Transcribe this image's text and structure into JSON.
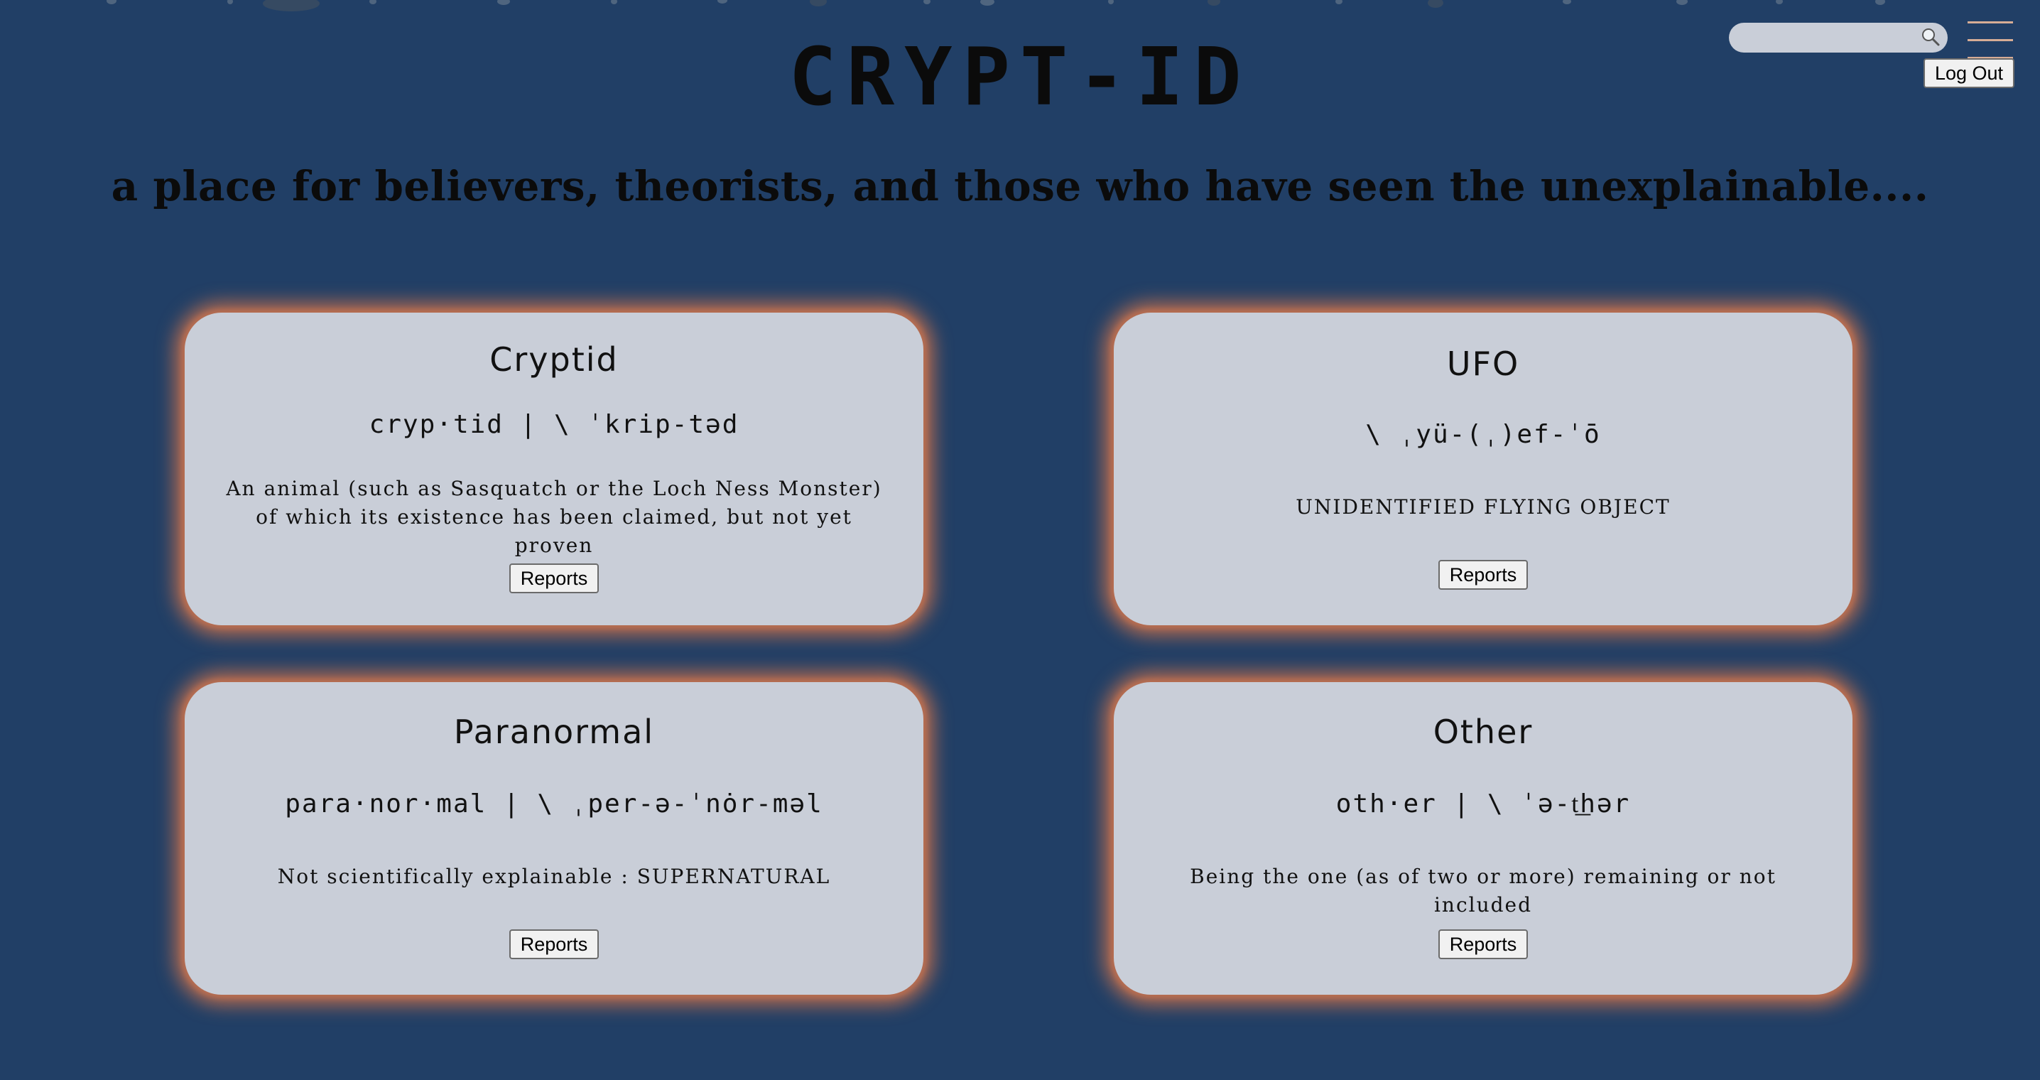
{
  "header": {
    "search_value": "",
    "search_icon": "magnifier-icon",
    "menu_icon": "hamburger-icon",
    "logout_label": "Log Out",
    "title": "CRYPT-ID",
    "tagline": "a place for believers, theorists, and those who have seen the unexplainable...."
  },
  "categories": [
    {
      "title": "Cryptid",
      "pronunciation": "cryp·tid | \\ ˈkrip-təd",
      "definition": "An animal (such as Sasquatch or the Loch Ness Monster) of which its existence has been claimed, but not yet proven",
      "button_label": "Reports"
    },
    {
      "title": "UFO",
      "pronunciation": "\\ ˌyü-(ˌ)ef-ˈō",
      "definition": "UNIDENTIFIED FLYING OBJECT",
      "button_label": "Reports"
    },
    {
      "title": "Paranormal",
      "pronunciation": "para·nor·mal | \\ ˌper-ə-ˈnȯr-məl",
      "definition": "Not scientifically explainable : SUPERNATURAL",
      "button_label": "Reports"
    },
    {
      "title": "Other",
      "pronunciation": "oth·er | \\ ˈə-t͟hər",
      "definition": "Being the one (as of two or more) remaining or not included",
      "button_label": "Reports"
    }
  ],
  "colors": {
    "background": "#213f66",
    "card": "#c9ced8",
    "card_glow": "#b66c4f",
    "menu_accent": "#d7ad96"
  }
}
